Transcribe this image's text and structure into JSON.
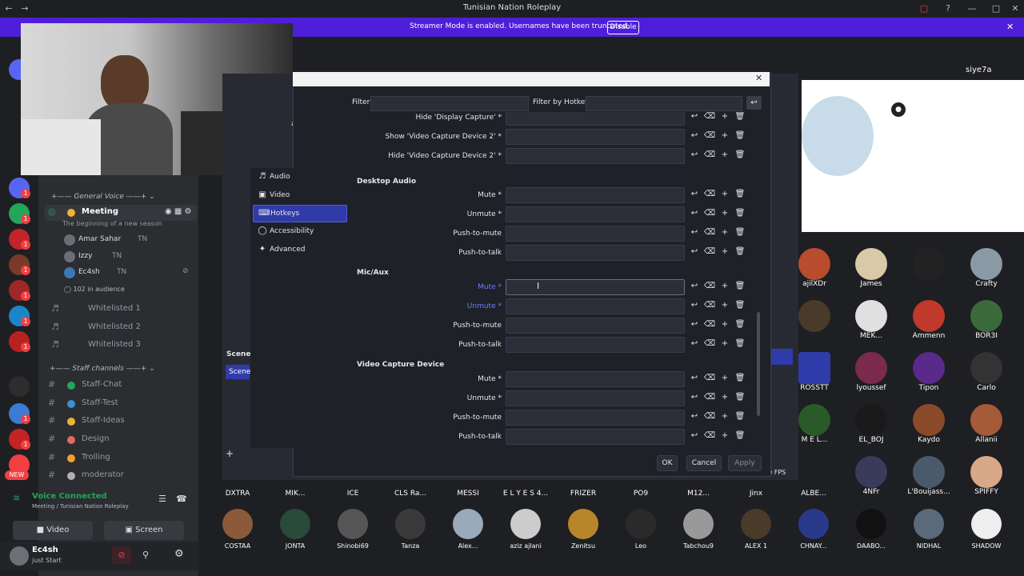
{
  "window": {
    "title": "Tunisian Nation Roleplay"
  },
  "streamer_bar": {
    "message": "Streamer Mode is enabled. Usernames have been truncated.",
    "button": "Disable"
  },
  "rail": {
    "badges": [
      "1",
      "1",
      "1",
      "1",
      "1",
      "1",
      "1",
      "1",
      "1",
      "1"
    ],
    "new_badge": "NEW"
  },
  "channels": {
    "general_voice": "General Voice",
    "meeting": {
      "name": "Meeting",
      "topic": "The beginning of a new season"
    },
    "meeting_users": [
      {
        "name": "Amar Sahar",
        "tag": "TN"
      },
      {
        "name": "Izzy",
        "tag": "TN"
      },
      {
        "name": "Ec4sh",
        "tag": "TN"
      }
    ],
    "audience": "102 in audience",
    "whitelisted": [
      "Whitelisted 1",
      "Whitelisted 2",
      "Whitelisted 3"
    ],
    "staff_channels": "Staff channels",
    "text_channels": [
      "Staff-Chat",
      "Staff-Test",
      "Staff-Ideas",
      "Design",
      "Trolling",
      "moderator"
    ]
  },
  "voice_panel": {
    "status": "Voice Connected",
    "location": "Meeting / Tunisian Nation Roleplay",
    "video_btn": "Video",
    "screen_btn": "Screen",
    "user_name": "Ec4sh",
    "user_status": "just Start"
  },
  "obs": {
    "partial_left": "ance",
    "scenes_label": "Scene",
    "scene_item": "Scene",
    "fps": "60 FPS"
  },
  "settings": {
    "filter_label": "Filter",
    "filter_hotkey_label": "Filter by Hotkey",
    "sidebar": [
      {
        "icon": "speaker-icon",
        "label": "Audio",
        "active": false
      },
      {
        "icon": "monitor-icon",
        "label": "Video",
        "active": false
      },
      {
        "icon": "keyboard-icon",
        "label": "Hotkeys",
        "active": true
      },
      {
        "icon": "accessibility-icon",
        "label": "Accessibility",
        "active": false
      },
      {
        "icon": "wrench-icon",
        "label": "Advanced",
        "active": false
      }
    ],
    "top_rows": [
      "Hide 'Display Capture' *",
      "Show 'Video Capture Device 2' *",
      "Hide 'Video Capture Device 2' *"
    ],
    "sections": [
      {
        "title": "Desktop Audio",
        "rows": [
          "Mute *",
          "Unmute *",
          "Push-to-mute",
          "Push-to-talk"
        ]
      },
      {
        "title": "Mic/Aux",
        "rows": [
          "Mute *",
          "Unmute *",
          "Push-to-mute",
          "Push-to-talk"
        ]
      },
      {
        "title": "Video Capture Device",
        "rows": [
          "Mute *",
          "Unmute *",
          "Push-to-mute",
          "Push-to-talk"
        ]
      }
    ],
    "buttons": {
      "ok": "OK",
      "cancel": "Cancel",
      "apply": "Apply"
    }
  },
  "gallery": {
    "top_user": "siye7a",
    "row1": [
      "ajilXDr",
      "James",
      "",
      "Crafty"
    ],
    "row2": [
      "",
      "MEK...",
      "Ammenn",
      "BOR3I"
    ],
    "row3": [
      "ROSSTT",
      "lyoussef",
      "Tipon",
      "Carlo"
    ],
    "row4": [
      "M E L...",
      "EL_BOJ",
      "Kaydo",
      "Allanii"
    ],
    "row5": [
      "4NFr",
      "L'Bouijass...",
      "SPIFFY"
    ],
    "strip1": [
      "DXTRA",
      "MIK...",
      "ICE",
      "CLS Ra...",
      "MESSI",
      "E L Y E S 4...",
      "FRIZER",
      "PO9",
      "M12...",
      "Jinx",
      "ALBE..."
    ],
    "strip2": [
      "COSTAA",
      "JONTA",
      "Shinobi69",
      "Tanza",
      "Alex...",
      "aziz ajlani",
      "Zenitsu",
      "Leo",
      "Tabchou9",
      "ALEX 1",
      "CHNAY...",
      "DAABO...",
      "NIDHAL",
      "SHADOW"
    ]
  }
}
